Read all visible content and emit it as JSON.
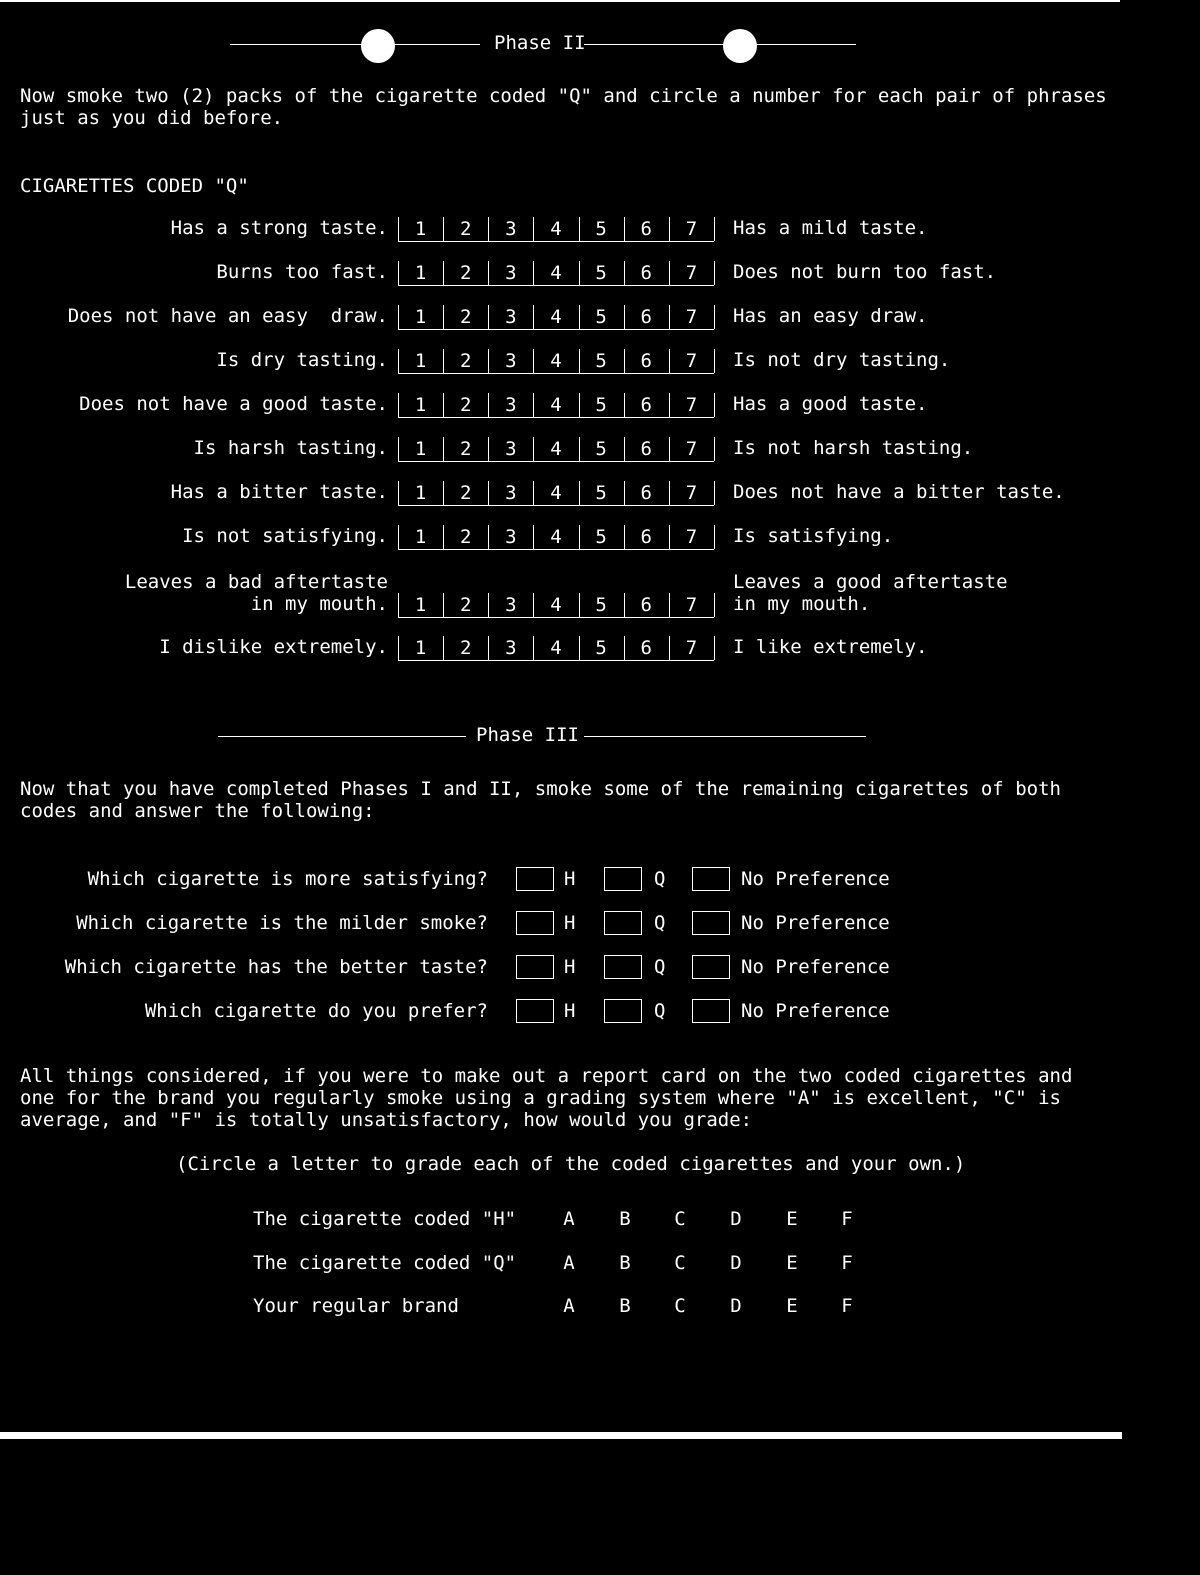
{
  "phase2": {
    "title": "Phase II",
    "intro": "Now smoke two (2) packs of the cigarette coded \"Q\" and circle a number for each pair of phrases\njust as you did before.",
    "section_label": "CIGARETTES CODED \"Q\"",
    "scale": [
      "1",
      "2",
      "3",
      "4",
      "5",
      "6",
      "7"
    ],
    "items": [
      {
        "left": "Has a strong taste.",
        "right": "Has a mild taste."
      },
      {
        "left": "Burns too fast.",
        "right": "Does not burn too fast."
      },
      {
        "left": "Does not have an easy  draw.",
        "right": "Has an easy draw."
      },
      {
        "left": "Is dry tasting.",
        "right": "Is not dry tasting."
      },
      {
        "left": "Does not have a good taste.",
        "right": "Has a good taste."
      },
      {
        "left": "Is harsh tasting.",
        "right": "Is not harsh tasting."
      },
      {
        "left": "Has a bitter taste.",
        "right": "Does not have a bitter taste."
      },
      {
        "left": "Is not satisfying.",
        "right": "Is satisfying."
      },
      {
        "left": "Leaves a bad aftertaste\nin my mouth.",
        "right": "Leaves a good aftertaste\nin my mouth."
      },
      {
        "left": "I dislike extremely.",
        "right": "I like extremely."
      }
    ]
  },
  "phase3": {
    "title": "Phase III",
    "intro": "Now that you have completed Phases I and II, smoke some of the remaining cigarettes of both\ncodes and answer the following:",
    "options": [
      "H",
      "Q",
      "No Preference"
    ],
    "questions": [
      "Which cigarette is more satisfying?",
      "Which cigarette is the milder smoke?",
      "Which cigarette has the better taste?",
      "Which cigarette do you prefer?"
    ],
    "report_intro": "All things considered, if you were to make out a report card on the two coded cigarettes and\none for the brand you regularly smoke using a grading system where \"A\" is excellent, \"C\" is\naverage, and \"F\" is totally unsatisfactory, how would you grade:",
    "instruction": "(Circle a letter to grade each of the coded cigarettes and your own.)",
    "grades": [
      "A",
      "B",
      "C",
      "D",
      "E",
      "F"
    ],
    "grade_rows": [
      "The cigarette coded \"H\"",
      "The cigarette coded \"Q\"",
      "Your regular brand"
    ]
  }
}
